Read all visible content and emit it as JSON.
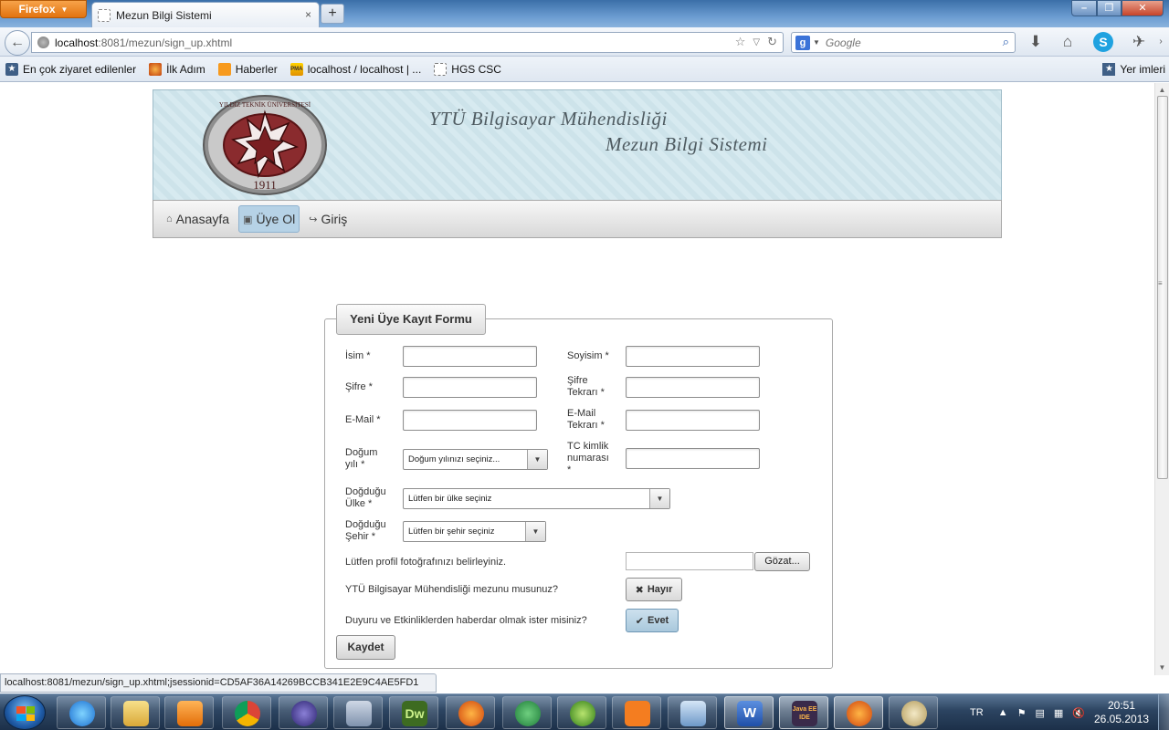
{
  "browser": {
    "menu_button": "Firefox",
    "tab_title": "Mezun Bilgi Sistemi",
    "new_tab": "+",
    "url_host": "localhost",
    "url_rest": ":8081/mezun/sign_up.xhtml",
    "search_placeholder": "Google",
    "bookmarks": [
      {
        "label": "En çok ziyaret edilenler",
        "icon": "bookmarks-star-icon"
      },
      {
        "label": "İlk Adım",
        "icon": "firefox-icon"
      },
      {
        "label": "Haberler",
        "icon": "rss-icon"
      },
      {
        "label": "localhost / localhost | ...",
        "icon": "phpmyadmin-icon"
      },
      {
        "label": "HGS CSC",
        "icon": "page-icon"
      }
    ],
    "bookmarks_right": "Yer imleri",
    "status_text": "localhost:8081/mezun/sign_up.xhtml;jsessionid=CD5AF36A14269BCCB341E2E9C4AE5FD1"
  },
  "banner": {
    "title_line1": "YTÜ Bilgisayar Mühendisliği",
    "title_line2": "Mezun Bilgi Sistemi",
    "seal_text": "YILDIZ TEKNİK ÜNİVERSİTESİ",
    "seal_year": "1911"
  },
  "menu": {
    "home": "Anasayfa",
    "signup": "Üye Ol",
    "login": "Giriş"
  },
  "form": {
    "legend": "Yeni Üye Kayıt Formu",
    "isim_label": "İsim *",
    "soyisim_label": "Soyisim *",
    "sifre_label": "Şifre *",
    "sifre_tekrar_line1": "Şifre",
    "sifre_tekrar_line2": "Tekrarı *",
    "email_label": "E-Mail *",
    "email_tekrar_line1": "E-Mail",
    "email_tekrar_line2": "Tekrarı *",
    "dogum_line1": "Doğum",
    "dogum_line2": "yılı *",
    "dogum_select": "Doğum yılınızı seçiniz...",
    "tc_line1": "TC kimlik",
    "tc_line2": "numarası",
    "tc_line3": "*",
    "ulke_line1": "Doğduğu",
    "ulke_line2": "Ülke *",
    "ulke_select": "Lütfen bir ülke seçiniz",
    "sehir_line1": "Doğduğu",
    "sehir_line2": "Şehir *",
    "sehir_select": "Lütfen bir şehir seçiniz",
    "photo_label": "Lütfen profil fotoğrafınızı belirleyiniz.",
    "browse_button": "Gözat...",
    "graduate_question": "YTÜ Bilgisayar Mühendisliği mezunu musunuz?",
    "graduate_toggle": "Hayır",
    "news_question": "Duyuru ve Etkinliklerden haberdar olmak ister misiniz?",
    "news_toggle": "Evet",
    "submit": "Kaydet"
  },
  "taskbar": {
    "lang": "TR",
    "time": "20:51",
    "date": "26.05.2013"
  },
  "colors": {
    "banner_bg": "#cde3ea",
    "menu_active": "#b6d2e6",
    "toggle_on": "#a9c8dc",
    "firefox_orange": "#e2730f"
  }
}
